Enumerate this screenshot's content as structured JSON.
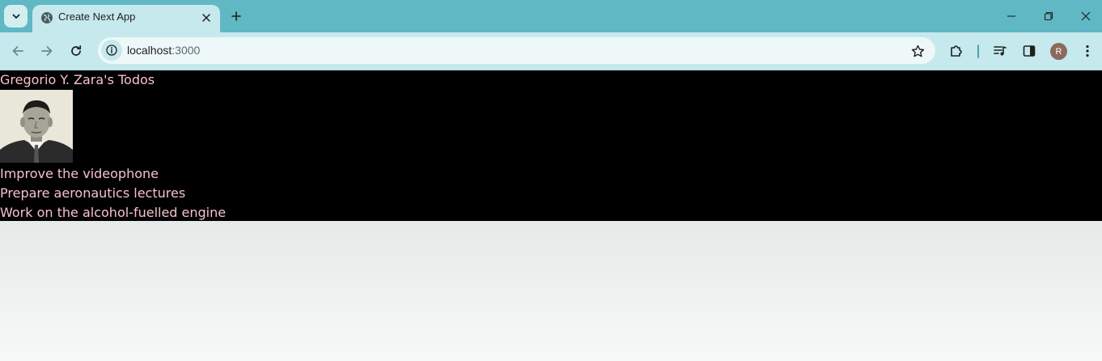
{
  "browser": {
    "tab": {
      "title": "Create Next App"
    },
    "address_bar": {
      "host": "localhost",
      "port": ":3000"
    },
    "profile_initial": "R"
  },
  "page": {
    "heading": "Gregorio Y. Zara's Todos",
    "todos": [
      "Improve the videophone",
      "Prepare aeronautics lectures",
      "Work on the alcohol-fuelled engine"
    ]
  },
  "colors": {
    "tabstrip": "#5fb8c3",
    "toolbar": "#c6e9ed",
    "page_background": "#000000",
    "page_text": "#f7c0cb"
  },
  "icons": {
    "tab_search": "chevron-down-icon",
    "favicon": "globe-icon",
    "close": "close-icon",
    "new_tab": "plus-icon",
    "back": "arrow-left-icon",
    "forward": "arrow-right-icon",
    "reload": "reload-icon",
    "site_info": "info-icon",
    "bookmark": "star-icon",
    "extensions": "puzzle-icon",
    "media": "media-queue-icon",
    "side_panel": "side-panel-icon",
    "menu": "kebab-menu-icon"
  }
}
